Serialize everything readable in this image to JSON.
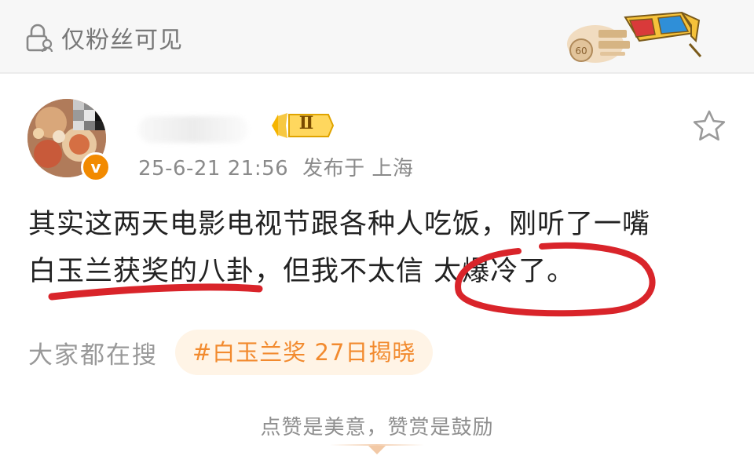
{
  "header": {
    "visibility_label": "仅粉丝可见",
    "lock_icon": "lock-person-icon",
    "campaign_badge": "campaign-3d-glasses-badge"
  },
  "post": {
    "author_verified_icon": "verified-v-icon",
    "level_badge": "Ⅱ",
    "timestamp": "25-6-21 21:56",
    "location": "发布于 上海",
    "favorite_icon": "star-outline-icon",
    "content_lines": [
      "其实这两天电影电视节跟各种人吃饭，刚听了一嘴",
      "白玉兰获奖的八卦，但我不太信  太爆冷了。"
    ]
  },
  "search": {
    "label": "大家都在搜",
    "tag": "#白玉兰奖 27日揭晓"
  },
  "footer": {
    "reward_text": "点赞是美意，赞赏是鼓励"
  },
  "colors": {
    "accent_orange": "#f28a2e",
    "annotation_red": "#d9242a",
    "muted_text": "#8a8a8a"
  }
}
